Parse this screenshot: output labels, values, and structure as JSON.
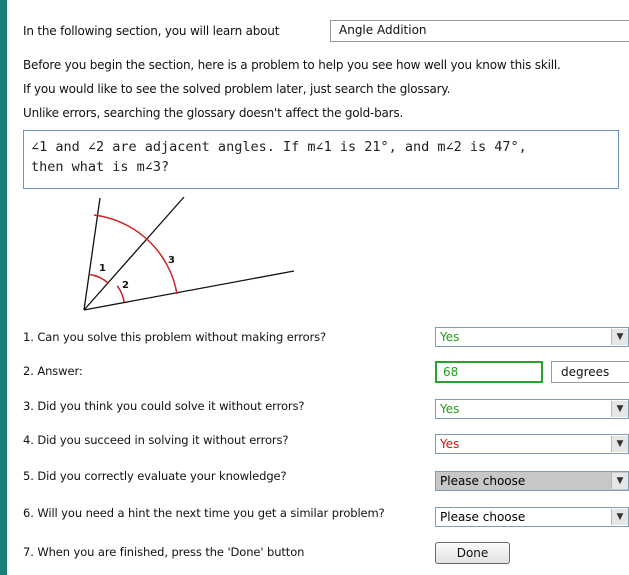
{
  "intro": {
    "lead": "In the following section, you will learn about",
    "topic": "Angle Addition",
    "line1": "Before you begin the section, here is a problem to help you see how well you know this skill.",
    "line2": "If you would like to see the solved problem later, just search the glossary.",
    "line3": "Unlike errors, searching the glossary doesn't affect the gold-bars."
  },
  "problem": {
    "text": "∠1 and ∠2 are adjacent angles. If m∠1 is 21°, and m∠2 is 47°,\nthen what is m∠3?"
  },
  "diagram": {
    "labels": [
      "1",
      "2",
      "3"
    ]
  },
  "questions": [
    {
      "text": "1. Can you solve this problem without making errors?",
      "value": "Yes",
      "value_color": "#1ea01e"
    },
    {
      "text": "2. Answer:",
      "value": "68",
      "unit": "degrees"
    },
    {
      "text": "3. Did you think you could solve it without errors?",
      "value": "Yes",
      "value_color": "#1ea01e"
    },
    {
      "text": "4. Did you succeed in solving it without errors?",
      "value": "Yes",
      "value_color": "#e01010"
    },
    {
      "text": "5. Did you correctly evaluate your knowledge?",
      "value": "Please choose",
      "value_color": "#000000"
    },
    {
      "text": "6. Will you need a hint the next time you get a similar problem?",
      "value": "Please choose",
      "value_color": "#000000"
    },
    {
      "text": "7. When you are finished, press the 'Done' button",
      "button": "Done"
    }
  ],
  "colors": {
    "accent_bar": "#1b7f7a",
    "correct": "#1ea01e",
    "incorrect": "#e01010",
    "angle_arc": "#cc2222",
    "problem_border": "#6d93bb"
  },
  "icons": {
    "dropdown": "chevron-down-icon"
  }
}
